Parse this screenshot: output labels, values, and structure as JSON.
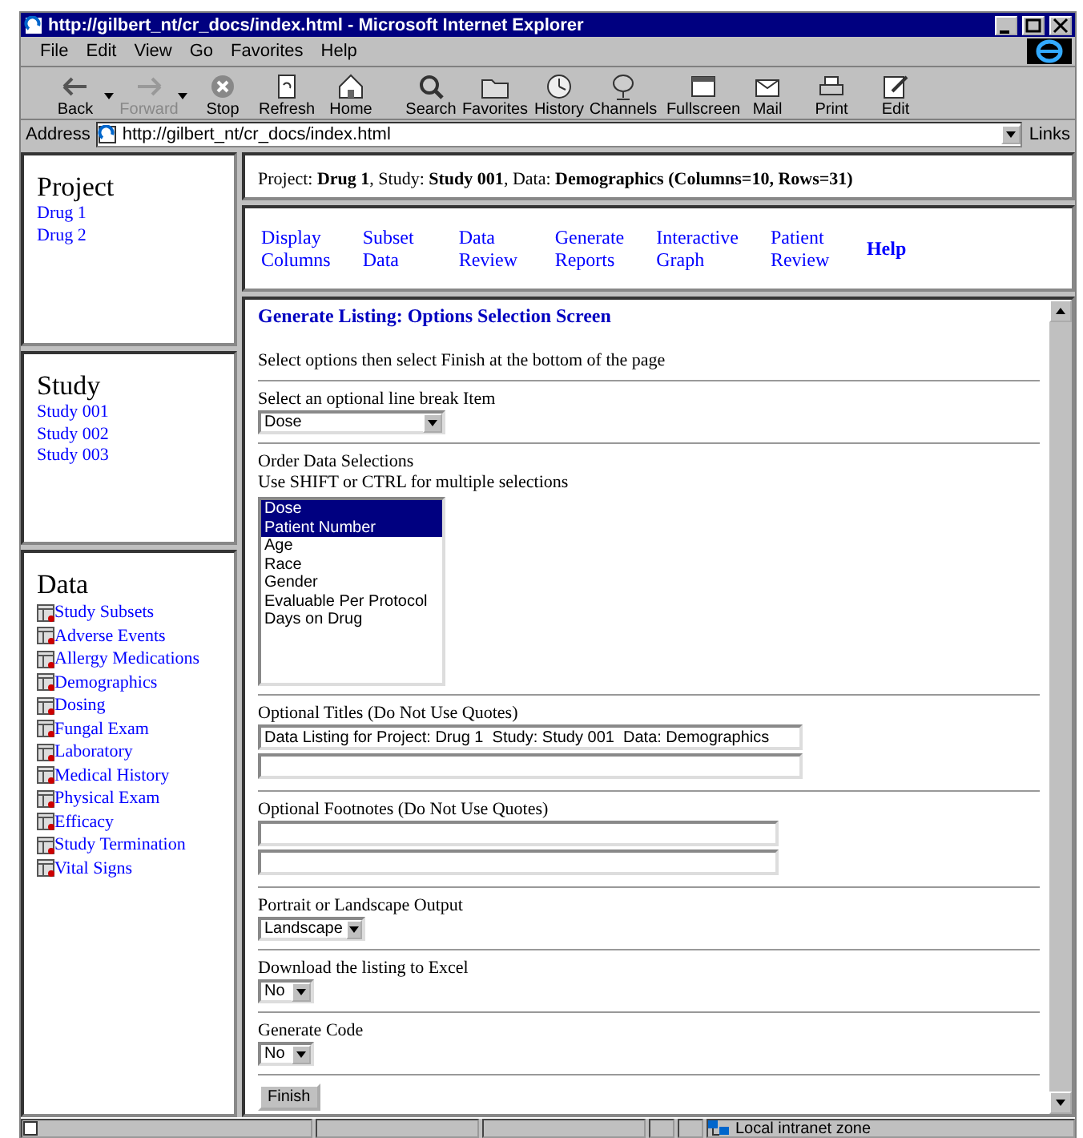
{
  "window": {
    "title": "http://gilbert_nt/cr_docs/index.html - Microsoft Internet Explorer"
  },
  "menu": [
    "File",
    "Edit",
    "View",
    "Go",
    "Favorites",
    "Help"
  ],
  "toolbar": [
    {
      "label": "Back",
      "disabled": false,
      "dropdown": true
    },
    {
      "label": "Forward",
      "disabled": true,
      "dropdown": true
    },
    {
      "label": "Stop",
      "disabled": false,
      "dropdown": false
    },
    {
      "label": "Refresh",
      "disabled": false,
      "dropdown": false
    },
    {
      "label": "Home",
      "disabled": false,
      "dropdown": false
    },
    {
      "label": "Search",
      "disabled": false,
      "dropdown": false
    },
    {
      "label": "Favorites",
      "disabled": false,
      "dropdown": false
    },
    {
      "label": "History",
      "disabled": false,
      "dropdown": false
    },
    {
      "label": "Channels",
      "disabled": false,
      "dropdown": false
    },
    {
      "label": "Fullscreen",
      "disabled": false,
      "dropdown": false
    },
    {
      "label": "Mail",
      "disabled": false,
      "dropdown": false
    },
    {
      "label": "Print",
      "disabled": false,
      "dropdown": false
    },
    {
      "label": "Edit",
      "disabled": false,
      "dropdown": false
    }
  ],
  "address": {
    "label": "Address",
    "value": "http://gilbert_nt/cr_docs/index.html",
    "links": "Links"
  },
  "sidebar": [
    {
      "heading": "Project",
      "items": [
        "Drug 1",
        "Drug 2"
      ]
    },
    {
      "heading": "Study",
      "items": [
        "Study 001",
        "Study 002",
        "Study 003"
      ]
    },
    {
      "heading": "Data",
      "items": [
        "Study Subsets",
        "Adverse Events",
        "Allergy Medications",
        "Demographics",
        "Dosing",
        "Fungal Exam",
        "Laboratory",
        "Medical History",
        "Physical Exam",
        "Efficacy",
        "Study Termination",
        "Vital Signs"
      ]
    }
  ],
  "context": "Project: **Drug 1**, Study: **Study 001**, Data: **Demographics (Columns=10, Rows=31)**",
  "nav": [
    "Display Columns",
    "Subset Data",
    "Data Review",
    "Generate Reports",
    "Interactive Graph",
    "Patient Review",
    "Help"
  ],
  "form": {
    "title": "Generate Listing: Options Selection Screen",
    "intro": "Select options then select Finish at the bottom of the page",
    "sections": [
      {
        "kind": "select",
        "labels": [
          "Select an optional line break Item"
        ],
        "value": "Dose"
      },
      {
        "kind": "listbox",
        "labels": [
          "Order Data Selections",
          "Use SHIFT or CTRL for multiple selections"
        ],
        "options": [
          {
            "label": "Dose",
            "selected": true
          },
          {
            "label": "Patient Number",
            "selected": true
          },
          {
            "label": "Age",
            "selected": false
          },
          {
            "label": "Race",
            "selected": false
          },
          {
            "label": "Gender",
            "selected": false
          },
          {
            "label": "Evaluable Per Protocol",
            "selected": false
          },
          {
            "label": "Days on Drug",
            "selected": false
          }
        ]
      },
      {
        "kind": "text",
        "labels": [
          "Optional Titles (Do Not Use Quotes)"
        ],
        "inputs": [
          {
            "kind": "filled",
            "value": "Data Listing for Project: Drug 1  Study: Study 001  Data: Demographics"
          },
          {
            "kind": "blank"
          }
        ]
      },
      {
        "kind": "text",
        "labels": [
          "Optional Footnotes (Do Not Use Quotes)"
        ],
        "inputs": [
          {
            "kind": "blank"
          },
          {
            "kind": "blank"
          }
        ]
      },
      {
        "kind": "select",
        "labels": [
          "Portrait or Landscape Output"
        ],
        "value": "Landscape"
      },
      {
        "kind": "select",
        "labels": [
          "Download the listing to Excel"
        ],
        "value": "No"
      },
      {
        "kind": "select",
        "labels": [
          "Generate Code"
        ],
        "value": "No"
      }
    ],
    "button": "Finish"
  },
  "status_bar": {
    "zone": "Local intranet zone"
  }
}
